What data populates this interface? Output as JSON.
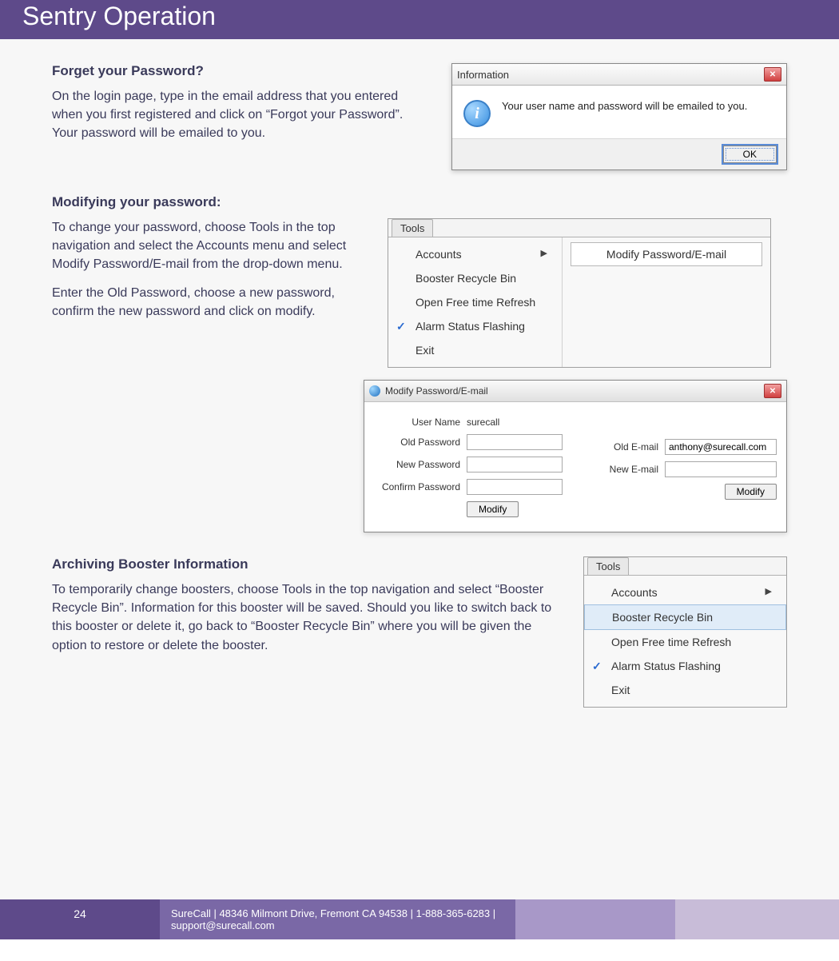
{
  "page": {
    "title": "Sentry Operation",
    "number": "24",
    "footer_text": "SureCall | 48346 Milmont Drive, Fremont CA 94538 | 1-888-365-6283 | support@surecall.com"
  },
  "sections": {
    "forgot": {
      "title": "Forget your Password?",
      "body": "On the login page, type in the email address that you entered when you first registered and click on “Forgot your Password”. Your password will be emailed to you."
    },
    "modify": {
      "title": "Modifying your password:",
      "body1": "To change your password, choose Tools in the top navigation and select the Accounts menu and select Modify Password/E-mail from the drop-down menu.",
      "body2": "Enter the Old Password, choose a new password, confirm the new password and click on modify."
    },
    "archive": {
      "title": "Archiving Booster Information",
      "body": "To temporarily change boosters, choose Tools in the top navigation and select “Booster Recycle Bin”. Information for this booster will be saved. Should you like to switch back to this booster or delete it, go back to “Booster Recycle Bin” where you will be given the option to restore or delete the booster."
    }
  },
  "info_dialog": {
    "title": "Information",
    "message": "Your user name and password will be emailed to you.",
    "ok": "OK"
  },
  "tools_menu": {
    "tab": "Tools",
    "items": [
      "Accounts",
      "Booster Recycle Bin",
      "Open Free time Refresh",
      "Alarm Status Flashing",
      "Exit"
    ],
    "submenu": "Modify Password/E-mail"
  },
  "modify_dialog": {
    "title": "Modify Password/E-mail",
    "fields": {
      "username_label": "User Name",
      "username_value": "surecall",
      "oldpw_label": "Old Password",
      "oldpw_value": "",
      "newpw_label": "New Password",
      "newpw_value": "",
      "confpw_label": "Confirm Password",
      "confpw_value": "",
      "oldemail_label": "Old E-mail",
      "oldemail_value": "anthony@surecall.com",
      "newemail_label": "New E-mail",
      "newemail_value": ""
    },
    "modify_btn": "Modify"
  }
}
